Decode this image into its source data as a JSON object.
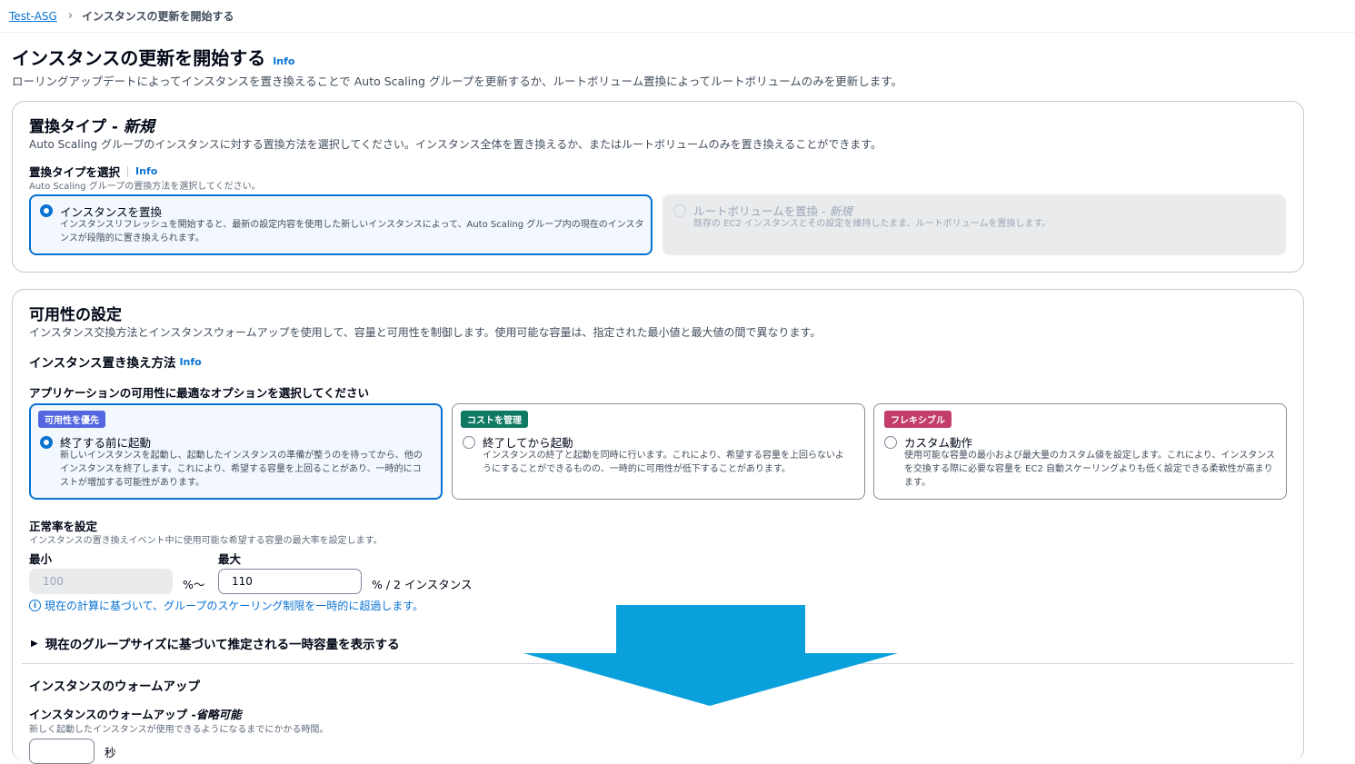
{
  "breadcrumb": {
    "parent": "Test-ASG",
    "separator": "›",
    "current": "インスタンスの更新を開始する"
  },
  "header": {
    "title": "インスタンスの更新を開始する",
    "info": "Info",
    "description": "ローリングアップデートによってインスタンスを置き換えることで Auto Scaling グループを更新するか、ルートボリューム置換によってルートボリュームのみを更新します。"
  },
  "replacement_type": {
    "title": "置換タイプ - ",
    "title_emphasis": "新規",
    "description": "Auto Scaling グループのインスタンスに対する置換方法を選択してください。インスタンス全体を置き換えるか、またはルートボリュームのみを置き換えることができます。",
    "select_label": "置換タイプを選択",
    "select_info": "Info",
    "select_hint": "Auto Scaling グループの置換方法を選択してください。",
    "options": [
      {
        "title": "インスタンスを置換",
        "desc": "インスタンスリフレッシュを開始すると、最新の設定内容を使用した新しいインスタンスによって、Auto Scaling グループ内の現在のインスタンスが段階的に置き換えられます。",
        "selected": true,
        "disabled": false
      },
      {
        "title": "ルートボリュームを置換 - ",
        "title_emphasis": "新規",
        "desc": "既存の EC2 インスタンスとその設定を維持したまま、ルートボリュームを置換します。",
        "selected": false,
        "disabled": true
      }
    ]
  },
  "availability": {
    "title": "可用性の設定",
    "description": "インスタンス交換方法とインスタンスウォームアップを使用して、容量と可用性を制御します。使用可能な容量は、指定された最小値と最大値の間で異なります。",
    "method_label": "インスタンス置き換え方法",
    "method_info": "Info",
    "choose_label": "アプリケーションの可用性に最適なオプションを選択してください",
    "options": [
      {
        "badge": "可用性を優先",
        "badge_color": "#5567e0",
        "title": "終了する前に起動",
        "desc": "新しいインスタンスを起動し、起動したインスタンスの準備が整うのを待ってから、他のインスタンスを終了します。これにより、希望する容量を上回ることがあり、一時的にコストが増加する可能性があります。",
        "selected": true
      },
      {
        "badge": "コストを管理",
        "badge_color": "#0f7a63",
        "title": "終了してから起動",
        "desc": "インスタンスの終了と起動を同時に行います。これにより、希望する容量を上回らないようにすることができるものの、一時的に可用性が低下することがあります。",
        "selected": false
      },
      {
        "badge": "フレキシブル",
        "badge_color": "#c33d69",
        "title": "カスタム動作",
        "desc": "使用可能な容量の最小および最大量のカスタム値を設定します。これにより、インスタンスを交換する際に必要な容量を EC2 自動スケーリングよりも低く設定できる柔軟性が高まります。",
        "selected": false
      }
    ],
    "health": {
      "label": "正常率を設定",
      "hint": "インスタンスの置き換えイベント中に使用可能な希望する容量の最大率を設定します。",
      "min_label": "最小",
      "max_label": "最大",
      "min_value": "100",
      "max_value": "110",
      "min_unit": "%～",
      "max_unit": "% / 2 インスタンス",
      "notice": "現在の計算に基づいて、グループのスケーリング制限を一時的に超過します。"
    },
    "expander": "現在のグループサイズに基づいて推定される一時容量を表示する",
    "warmup": {
      "section_title": "インスタンスのウォームアップ",
      "label": "インスタンスのウォームアップ - ",
      "label_emphasis": "省略可能",
      "hint": "新しく起動したインスタンスが使用できるようになるまでにかかる時間。",
      "unit": "秒"
    }
  },
  "overlay": {
    "color": "#0aa0dc",
    "icon": "down-arrow-icon"
  }
}
